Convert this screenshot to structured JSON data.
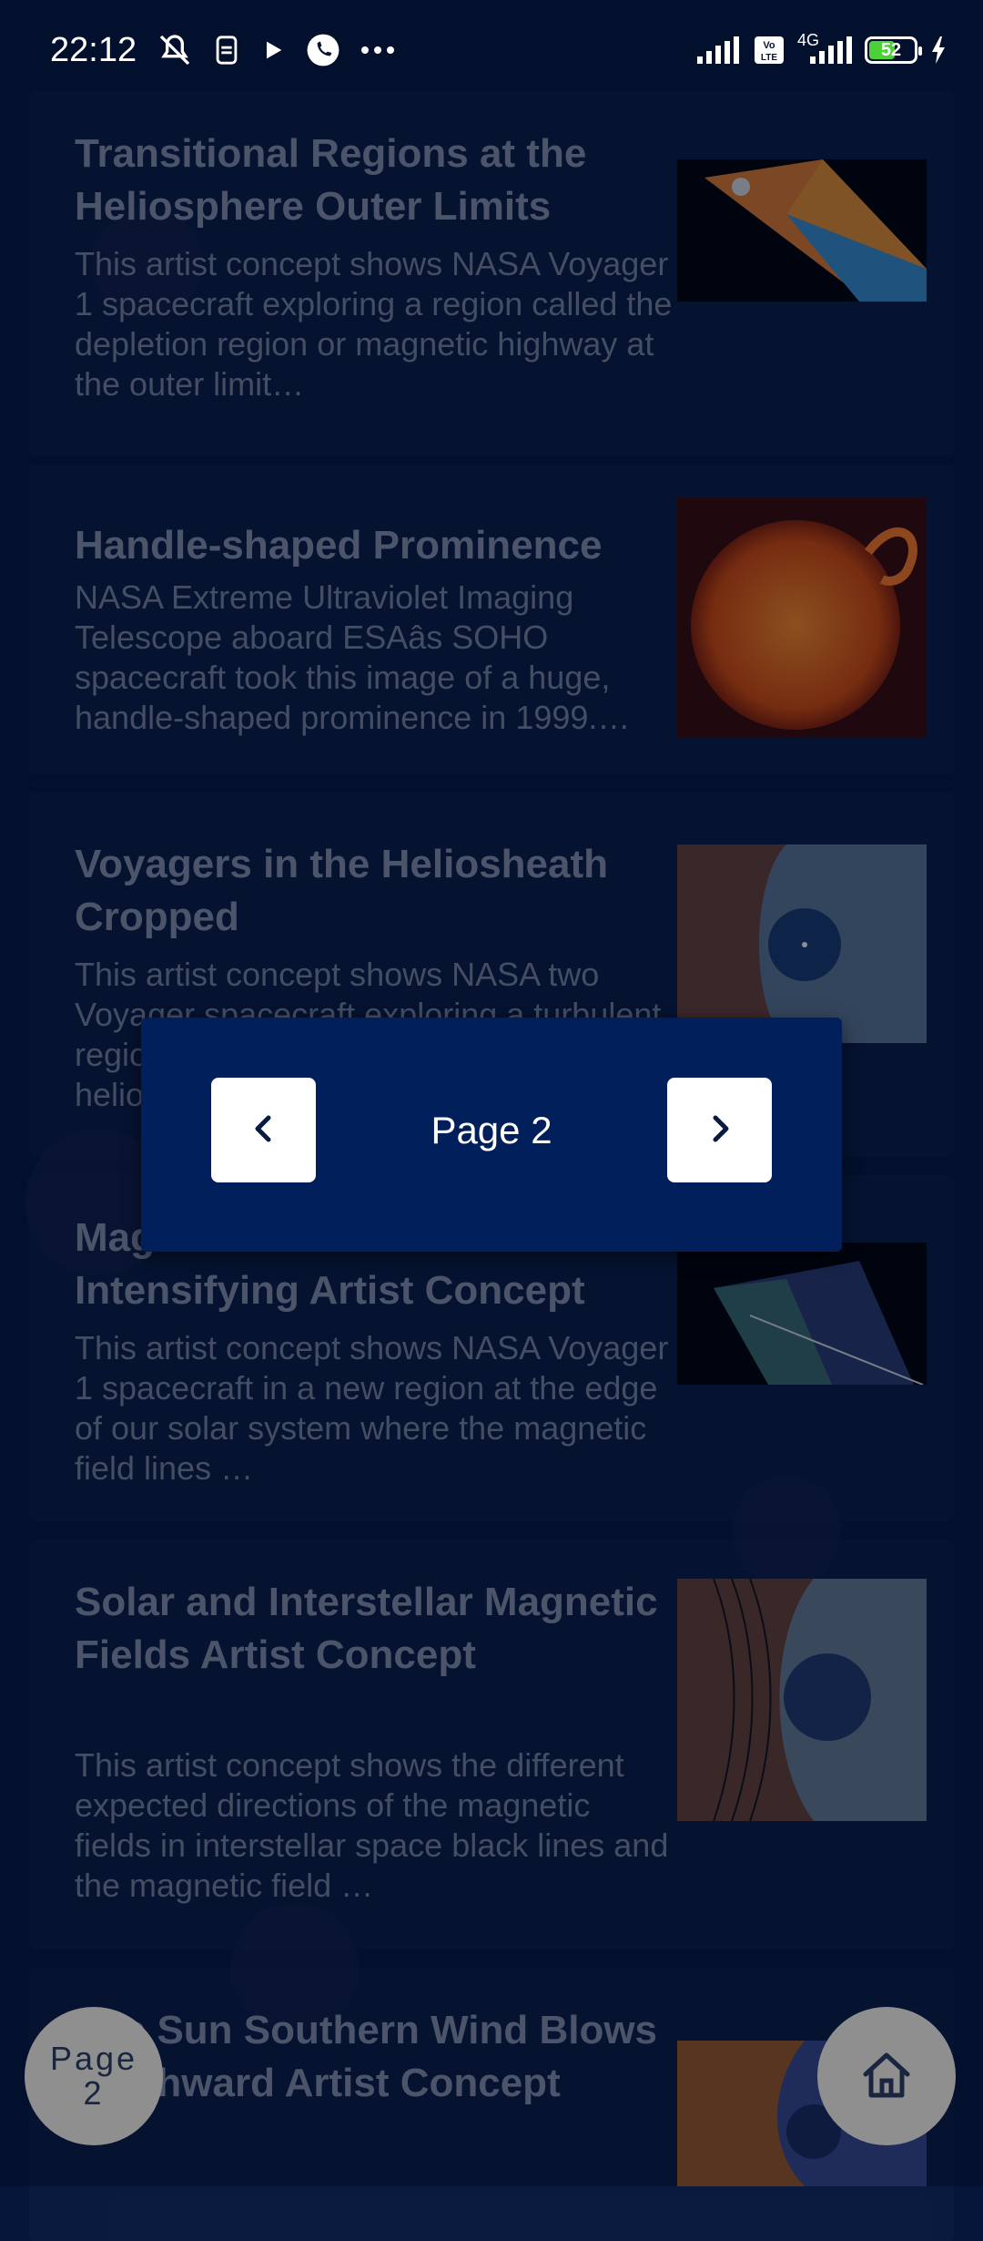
{
  "status_bar": {
    "time": "22:12",
    "battery_level": "52",
    "network_label": "4G",
    "icons": [
      "mute-icon",
      "sim-icon",
      "play-icon",
      "phone-icon",
      "more-icon",
      "signal-icon",
      "volte-icon",
      "signal-4g-icon",
      "battery-icon",
      "charging-icon"
    ]
  },
  "articles": [
    {
      "title": "Transitional Regions at the Heliosphere Outer Limits",
      "description": "This artist concept shows NASA Voyager 1 spacecraft exploring a region called the depletion region or magnetic highway at the outer limit…"
    },
    {
      "title": "Handle-shaped Prominence",
      "description": "NASA Extreme Ultraviolet Imaging Telescope aboard ESAâs SOHO spacecraft took this image of a huge, handle-shaped prominence in 1999.…"
    },
    {
      "title": "Voyagers in the Heliosheath Cropped",
      "description": "This artist concept shows NASA two Voyager spacecraft exploring a turbulent region of space known as the heliosheath…"
    },
    {
      "title": "Magnetic Field Lines Intensifying Artist Concept",
      "description": "This artist concept shows NASA Voyager 1 spacecraft in a new region at the edge of our solar system where the magnetic field lines …"
    },
    {
      "title": "Solar and Interstellar Magnetic Fields Artist Concept",
      "description": "This artist concept shows the different expected directions of the magnetic fields in interstellar space black lines and the magnetic field …"
    },
    {
      "title": "The Sun Southern Wind Blows Northward Artist Concept",
      "description": ""
    }
  ],
  "pager": {
    "label": "Page 2",
    "prev_icon": "chevron-left-icon",
    "next_icon": "chevron-right-icon"
  },
  "fab_page": {
    "line1": "Page",
    "line2": "2"
  },
  "fab_home": {
    "icon": "home-icon"
  },
  "colors": {
    "background": "#06163a",
    "pager_background": "#011f5b",
    "fab_background": "#8f8f8f",
    "battery_fill": "#4cd137"
  }
}
